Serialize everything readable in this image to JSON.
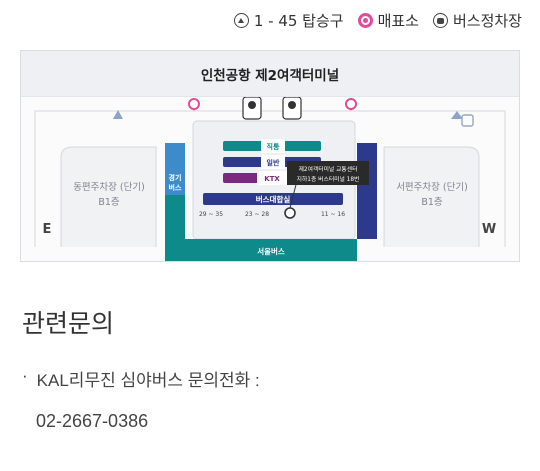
{
  "legend": {
    "gate": {
      "label": "1 - 45 탑승구",
      "icon": "boarding-gate-icon"
    },
    "ticket": {
      "label": "매표소",
      "icon": "ticket-office-icon",
      "color": "#e04b9b"
    },
    "bus": {
      "label": "버스정차장",
      "icon": "bus-stop-icon"
    }
  },
  "map": {
    "title": "인천공항 제2여객터미널",
    "east_parking": {
      "name": "동편주차장 (단기)",
      "floor": "B1층"
    },
    "west_parking": {
      "name": "서편주차장 (단기)",
      "floor": "B1층"
    },
    "east_letter": "E",
    "west_letter": "W",
    "gyeonggi_bus": "경기\n버스",
    "seoul_bus": "서울버스",
    "bus_lounge": "버스대합실",
    "rail_direct": "직통",
    "rail_general": "일반",
    "rail_ktx": "KTX",
    "gates": [
      "29 ~ 35",
      "23 ~ 28",
      "11 ~ 16"
    ],
    "callout": [
      "제2여객터미널 교통센터",
      "지하1층 버스터미널 18번"
    ],
    "colors": {
      "navy": "#2d3a8c",
      "teal": "#0f8a8a",
      "purple": "#7a2a7e",
      "ticket": "#e04b9b",
      "sky": "#3e8bc9"
    }
  },
  "inquiry": {
    "title": "관련문의",
    "bullet": "·",
    "label": "KAL리무진 심야버스 문의전화 :",
    "phone": "02-2667-0386"
  }
}
